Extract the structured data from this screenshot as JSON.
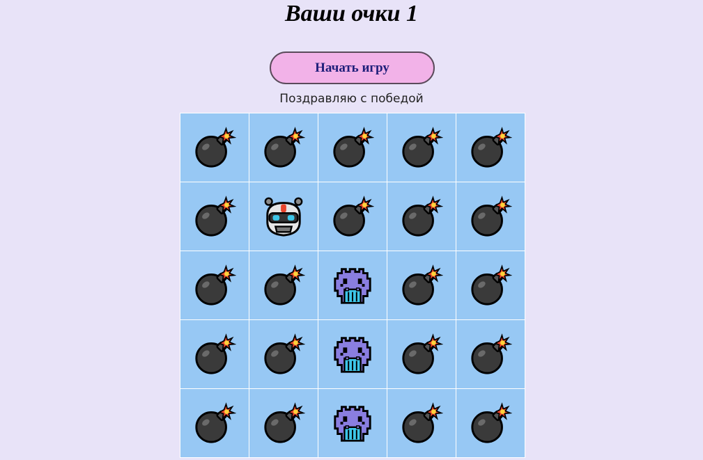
{
  "header": {
    "score_title": "Ваши очки 1"
  },
  "controls": {
    "start_label": "Начать игру"
  },
  "status": {
    "message": "Поздравляю с победой"
  },
  "colors": {
    "background": "#e8e3f8",
    "button": "#f2b2e8",
    "cell": "#97c8f4",
    "bomb": "#3a3a3a",
    "monster": "#8a7ee0",
    "monster_teeth": "#3dc6e8"
  },
  "board": {
    "rows": 5,
    "cols": 5,
    "cells": [
      [
        "bomb",
        "bomb",
        "bomb",
        "bomb",
        "bomb"
      ],
      [
        "bomb",
        "robot",
        "bomb",
        "bomb",
        "bomb"
      ],
      [
        "bomb",
        "bomb",
        "monster",
        "bomb",
        "bomb"
      ],
      [
        "bomb",
        "bomb",
        "monster",
        "bomb",
        "bomb"
      ],
      [
        "bomb",
        "bomb",
        "monster",
        "bomb",
        "bomb"
      ]
    ]
  }
}
